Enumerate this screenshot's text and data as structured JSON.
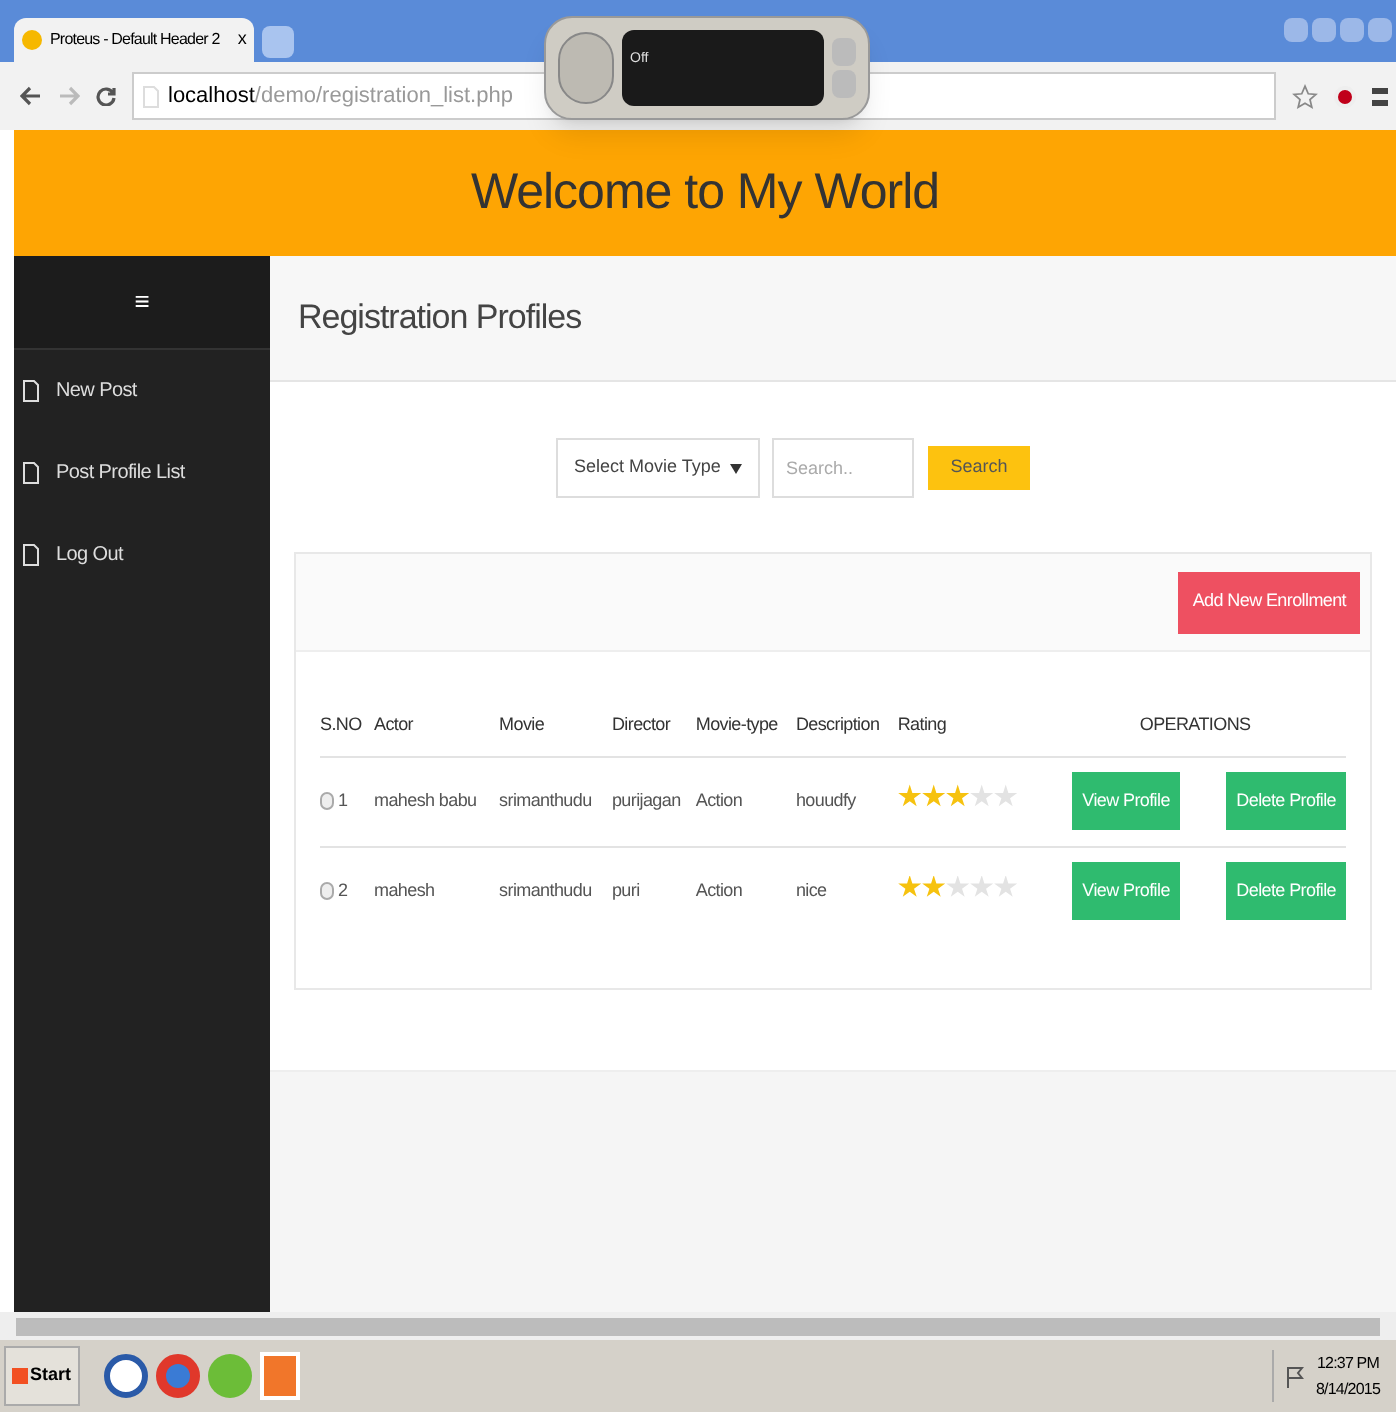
{
  "browser": {
    "tab_title": "Proteus - Default Header 2",
    "tab_close": "x",
    "url_host": "localhost",
    "url_path": "/demo/registration_list.php"
  },
  "voice_widget": {
    "status": "Off"
  },
  "header": {
    "title": "Welcome to My World"
  },
  "sidebar": {
    "menu_glyph": "≡",
    "items": [
      {
        "label": "New Post"
      },
      {
        "label": "Post Profile List"
      },
      {
        "label": "Log Out"
      }
    ]
  },
  "page_title": "Registration Profiles",
  "filter": {
    "select": "Select Movie Type",
    "search_placeholder": "Search..",
    "search_button": "Search"
  },
  "add_button": "Add New Enrollment",
  "table": {
    "columns": [
      "S.NO",
      "Actor",
      "Movie",
      "Director",
      "Movie-type",
      "Description",
      "Rating",
      "OPERATIONS"
    ],
    "rows": [
      {
        "checked": false,
        "sno": "1",
        "actor": "mahesh babu",
        "movie": "srimanthudu",
        "director": "purijagan",
        "type": "Action",
        "description": "houudfy",
        "stars": 3,
        "view": "View Profile",
        "delete": "Delete Profile"
      },
      {
        "checked": false,
        "sno": "2",
        "actor": "mahesh",
        "movie": "srimanthudu",
        "director": "puri",
        "type": "Action",
        "description": "nice",
        "stars": 2,
        "view": "View Profile",
        "delete": "Delete Profile"
      }
    ]
  },
  "taskbar": {
    "start": "Start",
    "time": "12:37 PM",
    "date": "8/14/2015"
  }
}
